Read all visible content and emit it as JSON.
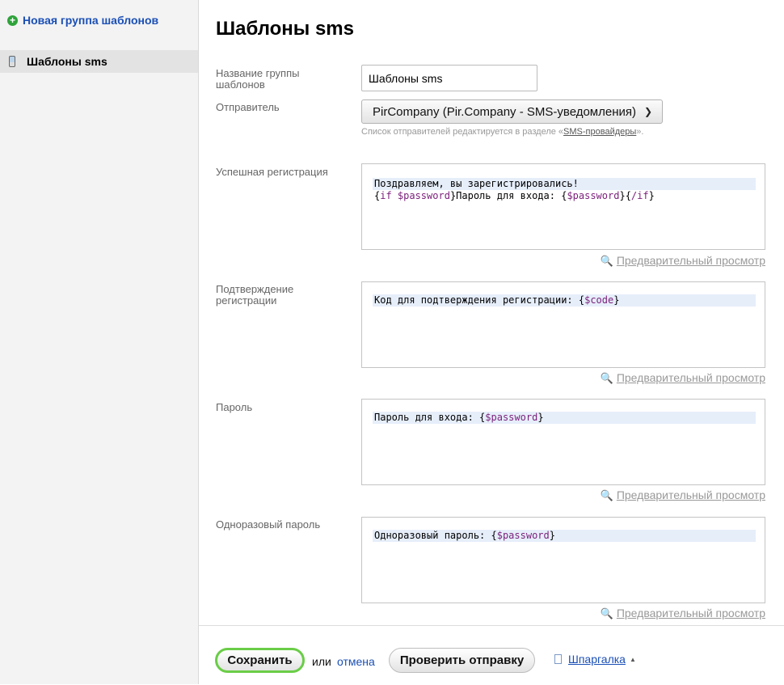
{
  "sidebar": {
    "new_group_label": "Новая группа шаблонов",
    "items": [
      {
        "label": "Шаблоны sms",
        "icon": "phone-icon"
      }
    ]
  },
  "main": {
    "title": "Шаблоны sms",
    "group_name": {
      "label": "Название группы шаблонов",
      "value": "Шаблоны sms"
    },
    "sender": {
      "label": "Отправитель",
      "selected": "PirCompany (Pir.Company - SMS-уведомления)",
      "hint_prefix": "Список отправителей редактируется в разделе «",
      "hint_link": "SMS-провайдеры",
      "hint_suffix": "»."
    },
    "templates": [
      {
        "label": "Успешная регистрация",
        "line1": "Поздравляем, вы зарегистрировались!",
        "line2_parts": [
          "{",
          "if $password",
          "}Пароль для входа: {",
          "$password",
          "}{",
          "/if",
          "}"
        ]
      },
      {
        "label": "Подтверждение регистрации",
        "line1_parts": [
          "Код для подтверждения регистрации: {",
          "$code",
          "}"
        ]
      },
      {
        "label": "Пароль",
        "line1_parts": [
          "Пароль для входа: {",
          "$password",
          "}"
        ]
      },
      {
        "label": "Одноразовый пароль",
        "line1_parts": [
          "Одноразовый пароль: {",
          "$password",
          "}"
        ]
      }
    ],
    "preview_label": "Предварительный просмотр"
  },
  "footer": {
    "save_label": "Сохранить",
    "or_text": "или",
    "cancel_label": "отмена",
    "check_label": "Проверить отправку",
    "cheatsheet_label": "Шпаргалка"
  },
  "colors": {
    "link": "#1a4fb5",
    "save_border": "#6acd47",
    "template_variable": "#7a1f7a",
    "line_highlight": "#e6eefa"
  }
}
